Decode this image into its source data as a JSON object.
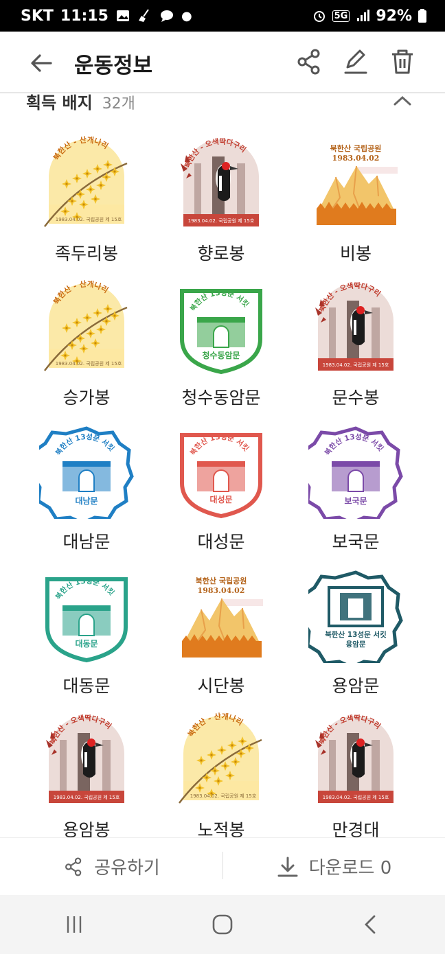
{
  "status": {
    "carrier": "SKT",
    "time": "11:15",
    "network": "5G",
    "battery": "92%"
  },
  "header": {
    "title": "운동정보"
  },
  "section": {
    "title": "획득 배지",
    "count": "32개"
  },
  "badges": [
    {
      "name": "족두리봉",
      "art": "forsythia"
    },
    {
      "name": "향로봉",
      "art": "woodpecker"
    },
    {
      "name": "비봉",
      "art": "peak"
    },
    {
      "name": "승가봉",
      "art": "forsythia"
    },
    {
      "name": "청수동암문",
      "art": "gate-green"
    },
    {
      "name": "문수봉",
      "art": "woodpecker"
    },
    {
      "name": "대남문",
      "art": "gate-blue"
    },
    {
      "name": "대성문",
      "art": "gate-red"
    },
    {
      "name": "보국문",
      "art": "gate-purple"
    },
    {
      "name": "대동문",
      "art": "gate-teal"
    },
    {
      "name": "시단봉",
      "art": "peak"
    },
    {
      "name": "용암문",
      "art": "gate-navy"
    },
    {
      "name": "용암봉",
      "art": "woodpecker"
    },
    {
      "name": "노적봉",
      "art": "forsythia"
    },
    {
      "name": "만경대",
      "art": "woodpecker"
    }
  ],
  "badge_text": {
    "forsythia_banner": "북한산 - 산개나리",
    "woodpecker_banner": "북한산 - 오색딱다구리",
    "footer": "1983.04.02. 국립공원 제 15호",
    "peak_top": "북한산 국립공원",
    "peak_date": "1983.04.02",
    "gate_circuit": "북한산 13성문 서킷"
  },
  "gate_names": {
    "gate-green": "청수동암문",
    "gate-blue": "대남문",
    "gate-red": "대성문",
    "gate-purple": "보국문",
    "gate-teal": "대동문",
    "gate-navy": "용암문"
  },
  "colors": {
    "forsythia": "#f3c22b",
    "woodpecker": "#c8463b",
    "peak": "#e07b1e",
    "gate-green": "#3aa64a",
    "gate-blue": "#1f7fc4",
    "gate-red": "#e0584e",
    "gate-purple": "#7b4aa8",
    "gate-teal": "#2aa38a",
    "gate-navy": "#1f5a66"
  },
  "bottom": {
    "share_label": "공유하기",
    "download_label": "다운로드 0"
  },
  "icons": {
    "back": "arrow-left-icon",
    "share": "share-icon",
    "edit": "edit-icon",
    "delete": "trash-icon",
    "collapse": "chevron-up-icon",
    "download": "download-icon",
    "recents": "recents-icon",
    "home": "home-icon",
    "nav_back": "back-icon"
  }
}
